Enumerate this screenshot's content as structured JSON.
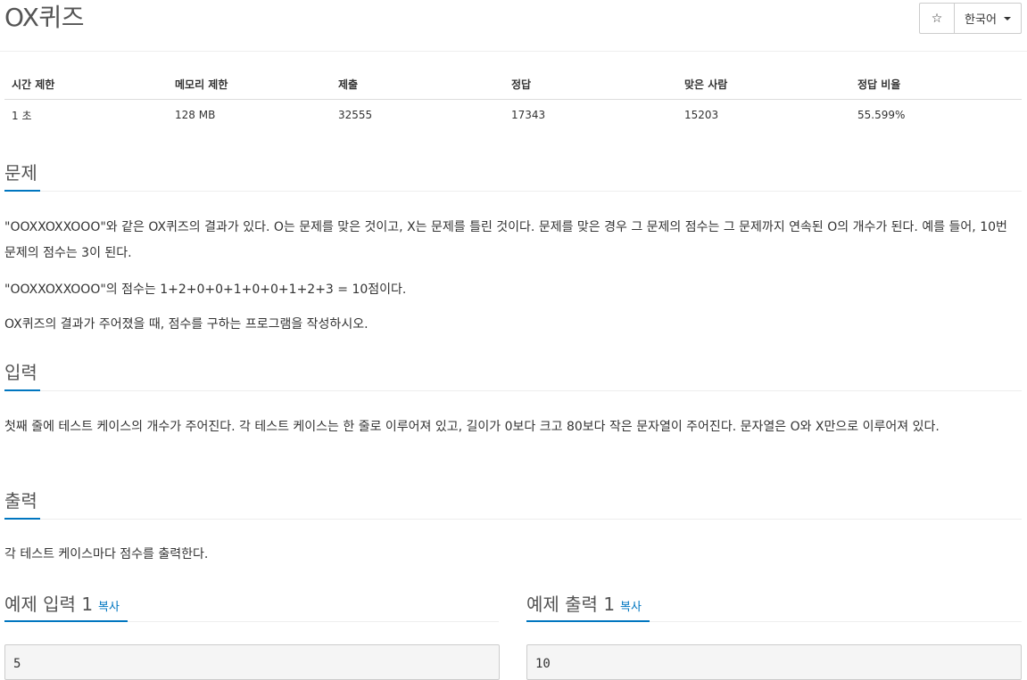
{
  "header": {
    "title": "OX퀴즈",
    "star_icon": "☆",
    "language": "한국어"
  },
  "info_table": {
    "headers": [
      "시간 제한",
      "메모리 제한",
      "제출",
      "정답",
      "맞은 사람",
      "정답 비율"
    ],
    "values": [
      "1 초",
      "128 MB",
      "32555",
      "17343",
      "15203",
      "55.599%"
    ]
  },
  "problem": {
    "heading": "문제",
    "paragraphs": [
      "\"OOXXOXXOOO\"와 같은 OX퀴즈의 결과가 있다. O는 문제를 맞은 것이고, X는 문제를 틀린 것이다. 문제를 맞은 경우 그 문제의 점수는 그 문제까지 연속된 O의 개수가 된다. 예를 들어, 10번 문제의 점수는 3이 된다.",
      "\"OOXXOXXOOO\"의 점수는 1+2+0+0+1+0+0+1+2+3 = 10점이다.",
      "OX퀴즈의 결과가 주어졌을 때, 점수를 구하는 프로그램을 작성하시오."
    ]
  },
  "input": {
    "heading": "입력",
    "paragraph": "첫째 줄에 테스트 케이스의 개수가 주어진다. 각 테스트 케이스는 한 줄로 이루어져 있고, 길이가 0보다 크고 80보다 작은 문자열이 주어진다. 문자열은 O와 X만으로 이루어져 있다."
  },
  "output": {
    "heading": "출력",
    "paragraph": "각 테스트 케이스마다 점수를 출력한다."
  },
  "samples": {
    "input_heading": "예제 입력 1",
    "output_heading": "예제 출력 1",
    "copy_label": "복사",
    "input_value": "5",
    "output_value": "10"
  },
  "colors": {
    "accent": "#0076c0",
    "sample_bg": "#f5f5f5"
  }
}
